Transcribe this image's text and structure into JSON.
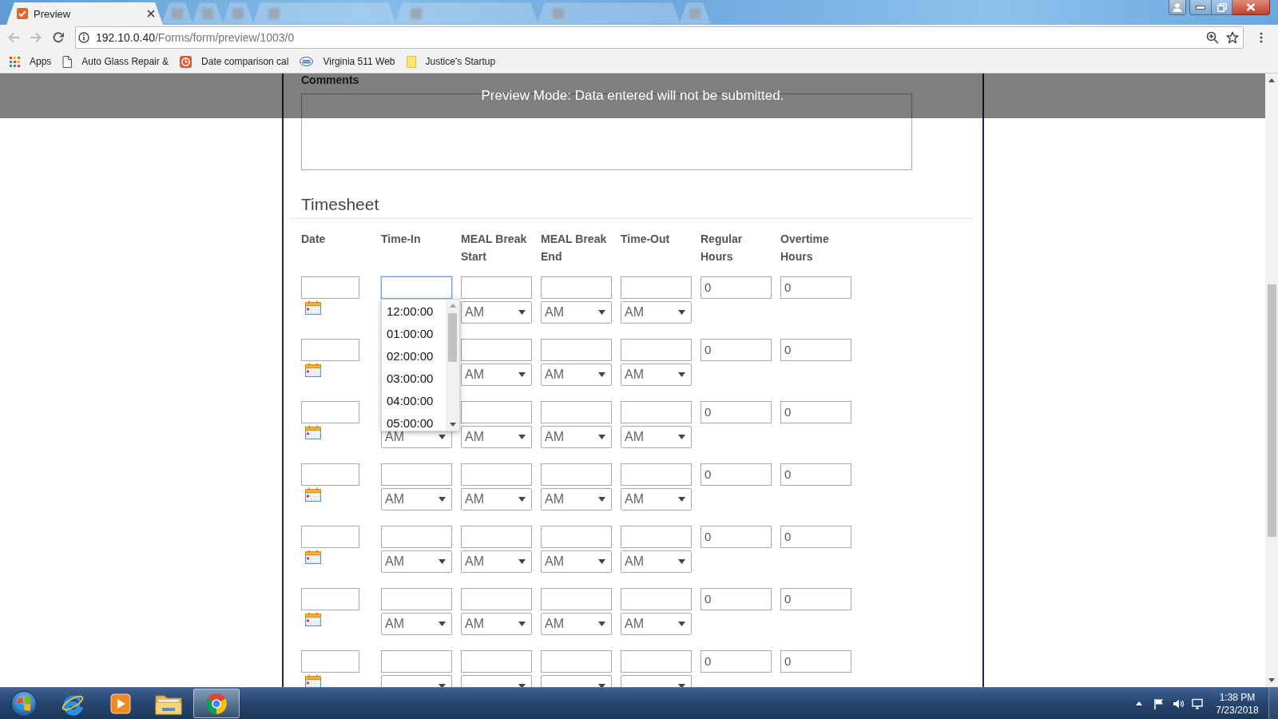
{
  "browser": {
    "tabs": [
      {
        "kind": "normal",
        "title": "Preview",
        "selected": true
      },
      {
        "kind": "pinned",
        "selected": false
      },
      {
        "kind": "pinned",
        "selected": false
      },
      {
        "kind": "pinned",
        "selected": false
      },
      {
        "kind": "normal",
        "selected": false
      },
      {
        "kind": "normal",
        "selected": false
      },
      {
        "kind": "normal",
        "selected": false
      },
      {
        "kind": "pinned",
        "selected": false
      }
    ],
    "nav_buttons": [
      {
        "kind": "back",
        "disabled": true
      },
      {
        "kind": "forward",
        "disabled": true
      },
      {
        "kind": "reload",
        "disabled": false
      }
    ],
    "address_bar": {
      "host": "192.10.0.40",
      "path": "/Forms/form/preview/1003/0"
    },
    "bookmarks": [
      {
        "kind": "apps",
        "label": "Apps"
      },
      {
        "kind": "page",
        "label": "Auto Glass Repair &"
      },
      {
        "kind": "clock",
        "label": "Date comparison cal"
      },
      {
        "kind": "oval",
        "label": "Virginia 511 Web"
      },
      {
        "kind": "note",
        "label": "Justice's Startup"
      }
    ]
  },
  "banner": {
    "text": "Preview Mode: Data entered will not be submitted."
  },
  "form": {
    "comments": {
      "label": "Comments"
    },
    "timesheet": {
      "title": "Timesheet",
      "columns": [
        "Date",
        "Time-In",
        "MEAL Break Start",
        "MEAL Break End",
        "Time-Out",
        "Regular Hours",
        "Overtime Hours"
      ],
      "rows": [
        {
          "date": {
            "focused": false
          },
          "times": [
            {
              "kind": "input",
              "focused": true,
              "dropdown": [
                {
                  "label": "12:00:00",
                  "selected": false
                },
                {
                  "label": "01:00:00",
                  "selected": false
                },
                {
                  "label": "02:00:00",
                  "selected": false
                },
                {
                  "label": "03:00:00",
                  "selected": false
                },
                {
                  "label": "04:00:00",
                  "selected": false
                },
                {
                  "label": "05:00:00",
                  "selected": false
                }
              ]
            },
            {
              "kind": "full",
              "focused": false,
              "ampm": "AM"
            },
            {
              "kind": "full",
              "focused": false,
              "ampm": "AM"
            },
            {
              "kind": "full",
              "focused": false,
              "ampm": "AM"
            }
          ],
          "regular_hours": "0",
          "overtime_hours": "0"
        },
        {
          "date": {
            "focused": false
          },
          "times": [
            {
              "kind": "covered"
            },
            {
              "kind": "full",
              "focused": false,
              "ampm": "AM"
            },
            {
              "kind": "full",
              "focused": false,
              "ampm": "AM"
            },
            {
              "kind": "full",
              "focused": false,
              "ampm": "AM"
            }
          ],
          "regular_hours": "0",
          "overtime_hours": "0"
        },
        {
          "date": {
            "focused": false
          },
          "times": [
            {
              "kind": "select",
              "ampm": "AM"
            },
            {
              "kind": "full",
              "focused": false,
              "ampm": "AM"
            },
            {
              "kind": "full",
              "focused": false,
              "ampm": "AM"
            },
            {
              "kind": "full",
              "focused": false,
              "ampm": "AM"
            }
          ],
          "regular_hours": "0",
          "overtime_hours": "0"
        },
        {
          "date": {
            "focused": false
          },
          "times": [
            {
              "kind": "full",
              "focused": false,
              "ampm": "AM"
            },
            {
              "kind": "full",
              "focused": false,
              "ampm": "AM"
            },
            {
              "kind": "full",
              "focused": false,
              "ampm": "AM"
            },
            {
              "kind": "full",
              "focused": false,
              "ampm": "AM"
            }
          ],
          "regular_hours": "0",
          "overtime_hours": "0"
        },
        {
          "date": {
            "focused": false
          },
          "times": [
            {
              "kind": "full",
              "focused": false,
              "ampm": "AM"
            },
            {
              "kind": "full",
              "focused": false,
              "ampm": "AM"
            },
            {
              "kind": "full",
              "focused": false,
              "ampm": "AM"
            },
            {
              "kind": "full",
              "focused": false,
              "ampm": "AM"
            }
          ],
          "regular_hours": "0",
          "overtime_hours": "0"
        },
        {
          "date": {
            "focused": false
          },
          "times": [
            {
              "kind": "full",
              "focused": false,
              "ampm": "AM"
            },
            {
              "kind": "full",
              "focused": false,
              "ampm": "AM"
            },
            {
              "kind": "full",
              "focused": false,
              "ampm": "AM"
            },
            {
              "kind": "full",
              "focused": false,
              "ampm": "AM"
            }
          ],
          "regular_hours": "0",
          "overtime_hours": "0"
        },
        {
          "date": {
            "focused": false
          },
          "times": [
            {
              "kind": "full",
              "focused": false
            },
            {
              "kind": "full",
              "focused": false
            },
            {
              "kind": "full",
              "focused": false
            },
            {
              "kind": "full",
              "focused": false
            }
          ],
          "regular_hours": "0",
          "overtime_hours": "0"
        }
      ]
    }
  },
  "taskbar": {
    "apps": [
      {
        "kind": "browser_e",
        "selected": false
      },
      {
        "kind": "player",
        "selected": false
      },
      {
        "kind": "folder",
        "selected": false
      },
      {
        "kind": "browser_round",
        "selected": true
      }
    ],
    "clock": {
      "time": "1:38 PM",
      "date": "7/23/2018"
    }
  }
}
